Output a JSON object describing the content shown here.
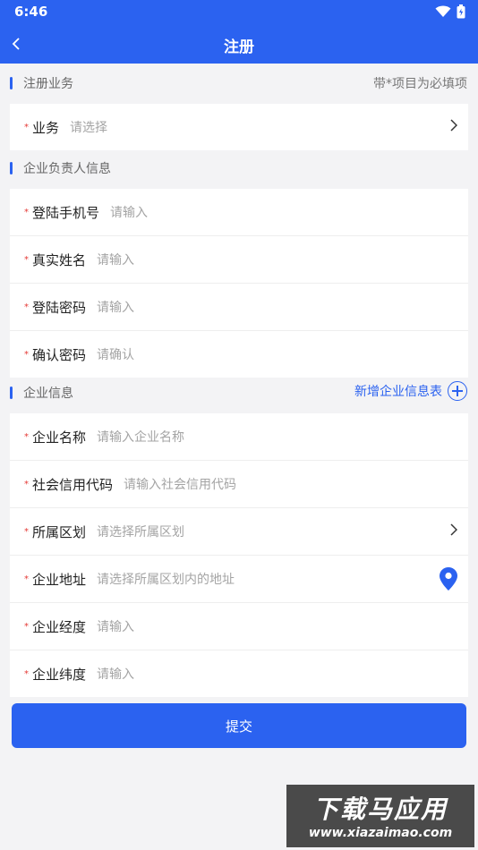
{
  "status": {
    "time": "6:46"
  },
  "header": {
    "title": "注册"
  },
  "sections": {
    "business": {
      "title": "注册业务",
      "note": "带*项目为必填项"
    },
    "owner": {
      "title": "企业负责人信息"
    },
    "company": {
      "title": "企业信息",
      "add_label": "新增企业信息表"
    }
  },
  "business_fields": [
    {
      "required": "*",
      "label": "业务",
      "placeholder": "请选择"
    }
  ],
  "owner_fields": [
    {
      "required": "*",
      "label": "登陆手机号",
      "placeholder": "请输入"
    },
    {
      "required": "*",
      "label": "真实姓名",
      "placeholder": "请输入"
    },
    {
      "required": "*",
      "label": "登陆密码",
      "placeholder": "请输入"
    },
    {
      "required": "*",
      "label": "确认密码",
      "placeholder": "请确认"
    }
  ],
  "company_fields": [
    {
      "required": "*",
      "label": "企业名称",
      "placeholder": "请输入企业名称"
    },
    {
      "required": "*",
      "label": "社会信用代码",
      "placeholder": "请输入社会信用代码"
    },
    {
      "required": "*",
      "label": "所属区划",
      "placeholder": "请选择所属区划"
    },
    {
      "required": "*",
      "label": "企业地址",
      "placeholder": "请选择所属区划内的地址"
    },
    {
      "required": "*",
      "label": "企业经度",
      "placeholder": "请输入"
    },
    {
      "required": "*",
      "label": "企业纬度",
      "placeholder": "请输入"
    }
  ],
  "submit": {
    "label": "提交"
  },
  "watermark": {
    "line1": "下载马应用",
    "line2": "www.xiazaimao.com"
  },
  "colors": {
    "primary": "#2b62f0",
    "required": "#e53935",
    "background": "#f3f3f5"
  }
}
